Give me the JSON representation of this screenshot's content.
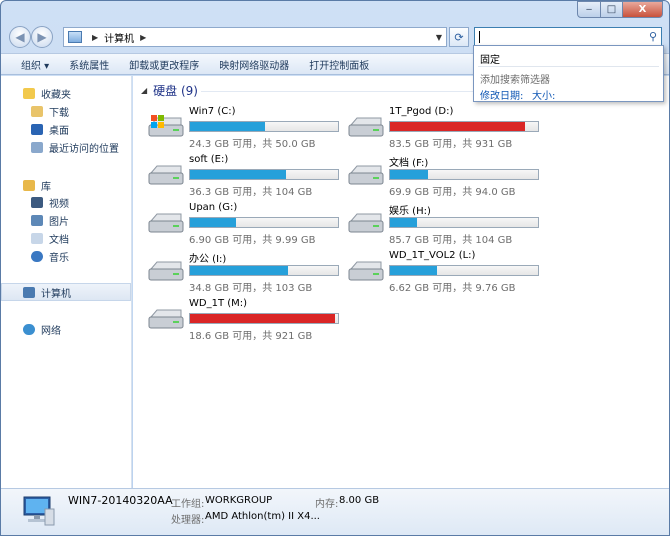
{
  "window": {
    "caption_min": "‒",
    "caption_max": "□",
    "caption_close": "X"
  },
  "address": {
    "path": "计算机"
  },
  "toolbar": {
    "organize": "组织 ▾",
    "system_properties": "系统属性",
    "uninstall": "卸载或更改程序",
    "map_drive": "映射网络驱动器",
    "control_panel": "打开控制面板"
  },
  "search_popup": {
    "pin": "固定",
    "hint": "添加搜索筛选器",
    "filter_date": "修改日期:",
    "filter_size": "大小:"
  },
  "sidebar": {
    "favorites": "收藏夹",
    "downloads": "下载",
    "desktop": "桌面",
    "recent": "最近访问的位置",
    "libraries": "库",
    "videos": "视频",
    "pictures": "图片",
    "documents": "文档",
    "music": "音乐",
    "computer": "计算机",
    "network": "网络"
  },
  "main": {
    "group_title": "硬盘 (9)"
  },
  "drives": [
    {
      "name": "Win7 (C:)",
      "info": "24.3 GB 可用，共 50.0 GB",
      "used_fraction": 0.51,
      "color": "#26a0da"
    },
    {
      "name": "1T_Pgod (D:)",
      "info": "83.5 GB 可用，共 931 GB",
      "used_fraction": 0.91,
      "color": "#da2626"
    },
    {
      "name": "soft (E:)",
      "info": "36.3 GB 可用，共 104 GB",
      "used_fraction": 0.65,
      "color": "#26a0da"
    },
    {
      "name": "文档 (F:)",
      "info": "69.9 GB 可用，共 94.0 GB",
      "used_fraction": 0.26,
      "color": "#26a0da"
    },
    {
      "name": "Upan (G:)",
      "info": "6.90 GB 可用，共 9.99 GB",
      "used_fraction": 0.31,
      "color": "#26a0da"
    },
    {
      "name": "娱乐 (H:)",
      "info": "85.7 GB 可用，共 104 GB",
      "used_fraction": 0.18,
      "color": "#26a0da"
    },
    {
      "name": "办公 (I:)",
      "info": "34.8 GB 可用，共 103 GB",
      "used_fraction": 0.66,
      "color": "#26a0da"
    },
    {
      "name": "WD_1T_VOL2 (L:)",
      "info": "6.62 GB 可用，共 9.76 GB",
      "used_fraction": 0.32,
      "color": "#26a0da"
    },
    {
      "name": "WD_1T (M:)",
      "info": "18.6 GB 可用，共 921 GB",
      "used_fraction": 0.98,
      "color": "#da2626"
    }
  ],
  "status": {
    "computer_name": "WIN7-20140320AA",
    "workgroup_label": "工作组:",
    "workgroup_value": "WORKGROUP",
    "memory_label": "内存:",
    "memory_value": "8.00 GB",
    "cpu_label": "处理器:",
    "cpu_value": "AMD Athlon(tm) II X4..."
  }
}
